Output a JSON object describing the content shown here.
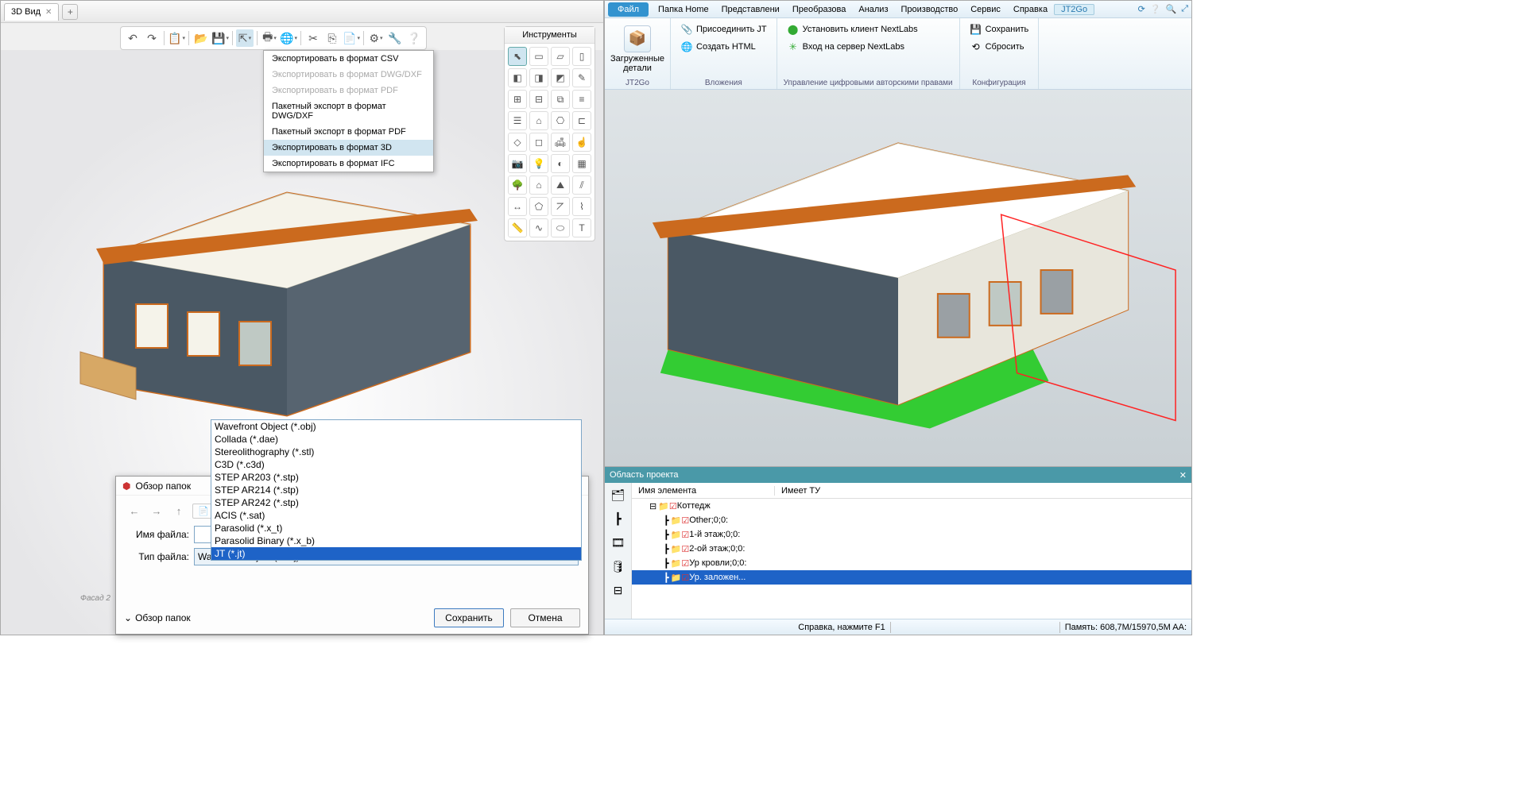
{
  "left": {
    "tab_title": "3D Вид",
    "tools_header": "Инструменты",
    "export_menu": [
      {
        "label": "Экспортировать в формат CSV",
        "disabled": false
      },
      {
        "label": "Экспортировать в формат DWG/DXF",
        "disabled": true
      },
      {
        "label": "Экспортировать в формат PDF",
        "disabled": true
      },
      {
        "label": "Пакетный экспорт в формат DWG/DXF",
        "disabled": false
      },
      {
        "label": "Пакетный экспорт в формат PDF",
        "disabled": false
      },
      {
        "label": "Экспортировать в формат 3D",
        "disabled": false,
        "highlight": true
      },
      {
        "label": "Экспортировать в формат IFC",
        "disabled": false
      }
    ],
    "dialog": {
      "title": "Обзор папок",
      "filename_label": "Имя файла:",
      "filetype_label": "Тип файла:",
      "folders_toggle": "Обзор папок",
      "save_btn": "Сохранить",
      "cancel_btn": "Отмена",
      "filetype_value": "Wavefront Object (*.obj)",
      "type_options": [
        "Wavefront Object (*.obj)",
        "Collada (*.dae)",
        "Stereolithography (*.stl)",
        "C3D (*.c3d)",
        "STEP AR203 (*.stp)",
        "STEP AR214 (*.stp)",
        "STEP AR242 (*.stp)",
        "ACIS (*.sat)",
        "Parasolid (*.x_t)",
        "Parasolid Binary (*.x_b)",
        "JT (*.jt)"
      ],
      "type_highlight": "JT (*.jt)"
    }
  },
  "right": {
    "menus": {
      "file": "Файл",
      "home": "Папка Home",
      "view": "Представлени",
      "transform": "Преобразова",
      "analysis": "Анализ",
      "production": "Производство",
      "service": "Сервис",
      "help": "Справка",
      "jt2go": "JT2Go"
    },
    "ribbon": {
      "big_btn": "Загруженные детали",
      "group1": "JT2Go",
      "attach_jt": "Присоединить JT",
      "create_html": "Создать HTML",
      "group2": "Вложения",
      "install_client": "Установить клиент NextLabs",
      "login_server": "Вход на сервер NextLabs",
      "group3": "Управление цифровыми авторскими правами",
      "save": "Сохранить",
      "reset": "Сбросить",
      "group4": "Конфигурация"
    },
    "project": {
      "header": "Область проекта",
      "col1": "Имя элемента",
      "col2": "Имеет ТУ",
      "rows": [
        {
          "indent": 0,
          "text": "Коттедж"
        },
        {
          "indent": 1,
          "text": "Other;0;0:"
        },
        {
          "indent": 1,
          "text": "1-й этаж;0;0:"
        },
        {
          "indent": 1,
          "text": "2-ой этаж;0;0:"
        },
        {
          "indent": 1,
          "text": "Ур кровли;0;0:"
        },
        {
          "indent": 1,
          "text": "Ур. заложен...",
          "sel": true
        }
      ]
    },
    "status": {
      "help": "Справка, нажмите F1",
      "memory": "Память: 608,7M/15970,5M  AA:"
    }
  }
}
